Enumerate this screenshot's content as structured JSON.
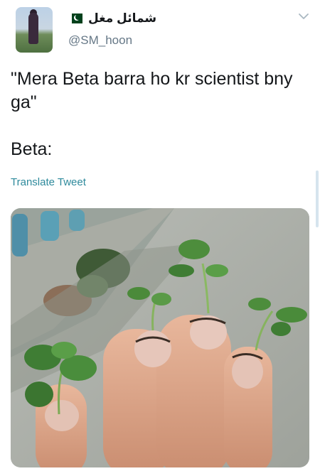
{
  "author": {
    "display_name": "شمائل مغل",
    "handle": "@SM_hoon",
    "flag": "pakistan-flag-icon"
  },
  "tweet": {
    "text": "\"Mera Beta barra ho kr scientist bny ga\"\n\nBeta:",
    "translate_label": "Translate Tweet"
  },
  "media": {
    "description_icon": "photo-image"
  },
  "colors": {
    "text": "#14171a",
    "secondary": "#657786",
    "link": "#2e8a9c"
  }
}
